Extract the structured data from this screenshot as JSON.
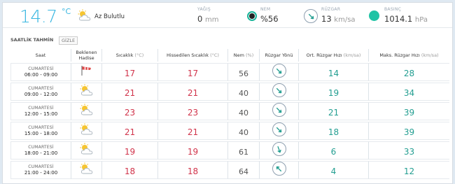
{
  "current": {
    "temp": "14.7",
    "unit": "°C",
    "condition_icon": "sun-cloud-icon",
    "condition": "Az Bulutlu",
    "yagis_label": "YAĞIŞ",
    "yagis_value": "0",
    "yagis_unit": "mm",
    "nem_label": "NEM",
    "nem_value": "%56",
    "ruzgar_label": "RÜZGAR",
    "ruzgar_value": "13",
    "ruzgar_unit": "km/sa",
    "basinc_label": "BASINÇ",
    "basinc_value": "1014.1",
    "basinc_unit": "hPa",
    "colors": {
      "accent": "#37b6e0",
      "teal": "#20c3a5",
      "red": "#d1344b"
    }
  },
  "section": {
    "title": "SAATLİK TAHMİN",
    "hide_label": "GİZLE"
  },
  "table": {
    "headers": {
      "saat": "Saat",
      "hadise_1": "Beklenen",
      "hadise_2": "Hadise",
      "sicaklik": "Sıcaklık",
      "sicaklik_u": "(°C)",
      "hissedilen": "Hissedilen Sıcaklık",
      "hissedilen_u": "(°C)",
      "nem": "Nem",
      "nem_u": "(%)",
      "ruzgar_yonu": "Rüzgar Yönü",
      "ort": "Ort. Rüzgar Hızı",
      "ort_u": "(km/sa)",
      "maks": "Maks. Rüzgar Hızı",
      "maks_u": "(km/sa)"
    },
    "rows": [
      {
        "day": "CUMARTESİ",
        "time": "06:00 - 09:00",
        "icon": "windsock-icon",
        "temp": "17",
        "feels": "17",
        "humidity": "56",
        "wind_dir_deg": 135,
        "avg": "14",
        "max": "28"
      },
      {
        "day": "CUMARTESİ",
        "time": "09:00 - 12:00",
        "icon": "sun-cloud-icon",
        "temp": "21",
        "feels": "21",
        "humidity": "40",
        "wind_dir_deg": 135,
        "avg": "19",
        "max": "34"
      },
      {
        "day": "CUMARTESİ",
        "time": "12:00 - 15:00",
        "icon": "sun-cloud-icon",
        "temp": "23",
        "feels": "23",
        "humidity": "40",
        "wind_dir_deg": 135,
        "avg": "21",
        "max": "39"
      },
      {
        "day": "CUMARTESİ",
        "time": "15:00 - 18:00",
        "icon": "sun-cloud-icon",
        "temp": "21",
        "feels": "21",
        "humidity": "40",
        "wind_dir_deg": 135,
        "avg": "18",
        "max": "39"
      },
      {
        "day": "CUMARTESİ",
        "time": "18:00 - 21:00",
        "icon": "sun-cloud-icon",
        "temp": "19",
        "feels": "19",
        "humidity": "61",
        "wind_dir_deg": 160,
        "avg": "6",
        "max": "33"
      },
      {
        "day": "CUMARTESİ",
        "time": "21:00 - 24:00",
        "icon": "sun-cloud-icon",
        "temp": "18",
        "feels": "18",
        "humidity": "64",
        "wind_dir_deg": 315,
        "avg": "4",
        "max": "12"
      }
    ]
  }
}
